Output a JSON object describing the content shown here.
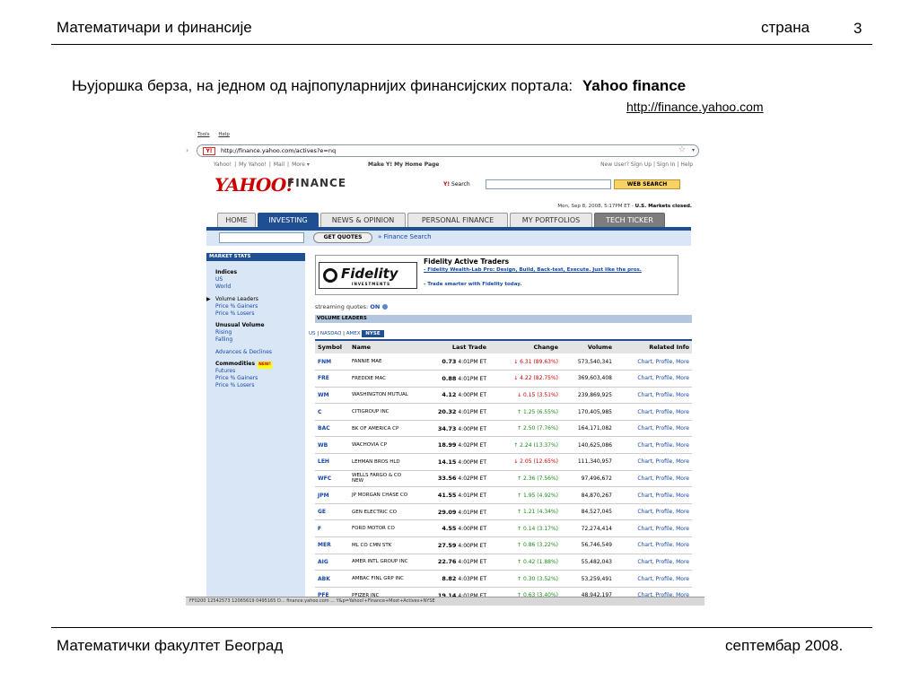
{
  "slide": {
    "header_title": "Математичари и финансије",
    "page_label": "страна",
    "page_number": "3",
    "subtitle": "Њујоршка берза, на једном од најпопуларнијих финансијских портала:",
    "subtitle_brand": "Yahoo finance",
    "url": "http://finance.yahoo.com",
    "footer_left": "Математички факултет Београд",
    "footer_right": "септембар 2008."
  },
  "browser": {
    "menu": [
      "Tools",
      "Help"
    ],
    "address": "http://finance.yahoo.com/actives?e=nq",
    "status_text": "FF0200 12542573 12065619 0495165 D... finance.yahoo.com ... Y&p=Yahoo!+Finance+Most+Actives+NYSE"
  },
  "yahoo": {
    "topnav_left": [
      "Yahoo!",
      "|",
      "My Yahoo!",
      "|",
      "Mail",
      "|",
      "More ▾"
    ],
    "topnav_mid": "Make Y! My Home Page",
    "topnav_right": "New User? Sign Up  |  Sign In  |  Help",
    "logo": "YAHOO!",
    "logo_suffix": "FINANCE",
    "search_label": "Search",
    "search_button": "WEB SEARCH",
    "date_line": "Mon, Sep 8, 2008, 5:17PM ET - ",
    "date_bold": "U.S. Markets closed.",
    "tabs": [
      "HOME",
      "INVESTING",
      "NEWS & OPINION",
      "PERSONAL FINANCE",
      "MY PORTFOLIOS",
      "TECH TICKER"
    ],
    "get_quotes": "GET QUOTES",
    "finance_search": "» Finance Search"
  },
  "sidebar": {
    "header": "MARKET STATS",
    "indices": "Indices",
    "us": "US",
    "world": "World",
    "volume_leaders": "Volume Leaders",
    "price_gainers": "Price % Gainers",
    "price_losers": "Price % Losers",
    "unusual_volume": "Unusual Volume",
    "rising": "Rising",
    "falling": "Falling",
    "advances_declines": "Advances & Declines",
    "commodities": "Commodities",
    "new_badge": "NEW!",
    "futures": "Futures",
    "c_price_gainers": "Price % Gainers",
    "c_price_losers": "Price % Losers"
  },
  "ad": {
    "brand": "Fidelity",
    "brand_sub": "INVESTMENTS",
    "title": "Fidelity Active Traders",
    "line1": "- Fidelity Wealth-Lab Pro: Design, Build, Back-test, Execute. Just like the pros.",
    "line2": "- Trade smarter with Fidelity today."
  },
  "streaming": {
    "label": "streaming quotes:",
    "value": "ON"
  },
  "volume_leaders": {
    "header": "VOLUME LEADERS",
    "exchanges": [
      "US",
      "NASDAQ",
      "AMEX"
    ],
    "active_exchange": "NYSE",
    "columns": [
      "Symbol",
      "Name",
      "Last Trade",
      "Change",
      "Volume",
      "Related Info"
    ],
    "rows": [
      {
        "sym": "FNM",
        "name": "FANNIE MAE",
        "price": "0.73",
        "time": "4:01PM ET",
        "dir": "down",
        "chg": "6.31 (89.63%)",
        "vol": "573,540,341",
        "rel": "Chart, Profile, More"
      },
      {
        "sym": "FRE",
        "name": "FREDDIE MAC",
        "price": "0.88",
        "time": "4:01PM ET",
        "dir": "down",
        "chg": "4.22 (82.75%)",
        "vol": "369,603,408",
        "rel": "Chart, Profile, More"
      },
      {
        "sym": "WM",
        "name": "WASHINGTON MUTUAL",
        "price": "4.12",
        "time": "4:00PM ET",
        "dir": "down",
        "chg": "0.15 (3.51%)",
        "vol": "239,869,925",
        "rel": "Chart, Profile, More"
      },
      {
        "sym": "C",
        "name": "CITIGROUP INC",
        "price": "20.32",
        "time": "4:01PM ET",
        "dir": "up",
        "chg": "1.25 (6.55%)",
        "vol": "170,405,985",
        "rel": "Chart, Profile, More"
      },
      {
        "sym": "BAC",
        "name": "BK OF AMERICA CP",
        "price": "34.73",
        "time": "4:00PM ET",
        "dir": "up",
        "chg": "2.50 (7.76%)",
        "vol": "164,171,082",
        "rel": "Chart, Profile, More"
      },
      {
        "sym": "WB",
        "name": "WACHOVIA CP",
        "price": "18.99",
        "time": "4:02PM ET",
        "dir": "up",
        "chg": "2.24 (13.37%)",
        "vol": "140,625,086",
        "rel": "Chart, Profile, More"
      },
      {
        "sym": "LEH",
        "name": "LEHMAN BROS HLD",
        "price": "14.15",
        "time": "4:00PM ET",
        "dir": "down",
        "chg": "2.05 (12.65%)",
        "vol": "111,340,957",
        "rel": "Chart, Profile, More"
      },
      {
        "sym": "WFC",
        "name": "WELLS FARGO & CO NEW",
        "price": "33.56",
        "time": "4:02PM ET",
        "dir": "up",
        "chg": "2.36 (7.56%)",
        "vol": "97,496,672",
        "rel": "Chart, Profile, More"
      },
      {
        "sym": "JPM",
        "name": "JP MORGAN CHASE CO",
        "price": "41.55",
        "time": "4:01PM ET",
        "dir": "up",
        "chg": "1.95 (4.92%)",
        "vol": "84,870,267",
        "rel": "Chart, Profile, More"
      },
      {
        "sym": "GE",
        "name": "GEN ELECTRIC CO",
        "price": "29.09",
        "time": "4:01PM ET",
        "dir": "up",
        "chg": "1.21 (4.34%)",
        "vol": "84,527,045",
        "rel": "Chart, Profile, More"
      },
      {
        "sym": "F",
        "name": "FORD MOTOR CO",
        "price": "4.55",
        "time": "4:00PM ET",
        "dir": "up",
        "chg": "0.14 (3.17%)",
        "vol": "72,274,414",
        "rel": "Chart, Profile, More"
      },
      {
        "sym": "MER",
        "name": "ML CO CMN STK",
        "price": "27.59",
        "time": "4:00PM ET",
        "dir": "up",
        "chg": "0.86 (3.22%)",
        "vol": "56,746,549",
        "rel": "Chart, Profile, More"
      },
      {
        "sym": "AIG",
        "name": "AMER INTL GROUP INC",
        "price": "22.76",
        "time": "4:01PM ET",
        "dir": "up",
        "chg": "0.42 (1.88%)",
        "vol": "55,482,043",
        "rel": "Chart, Profile, More"
      },
      {
        "sym": "ABK",
        "name": "AMBAC FINL GRP INC",
        "price": "8.82",
        "time": "4:03PM ET",
        "dir": "up",
        "chg": "0.30 (3.52%)",
        "vol": "53,259,491",
        "rel": "Chart, Profile, More"
      },
      {
        "sym": "PFE",
        "name": "PFIZER INC",
        "price": "19.14",
        "time": "4:01PM ET",
        "dir": "up",
        "chg": "0.63 (3.40%)",
        "vol": "48,942,197",
        "rel": "Chart, Profile, More"
      }
    ]
  },
  "colors": {
    "yahoo_blue": "#1f4e93",
    "yahoo_red": "#c00",
    "up": "#1a8a1a",
    "down": "#c00"
  }
}
